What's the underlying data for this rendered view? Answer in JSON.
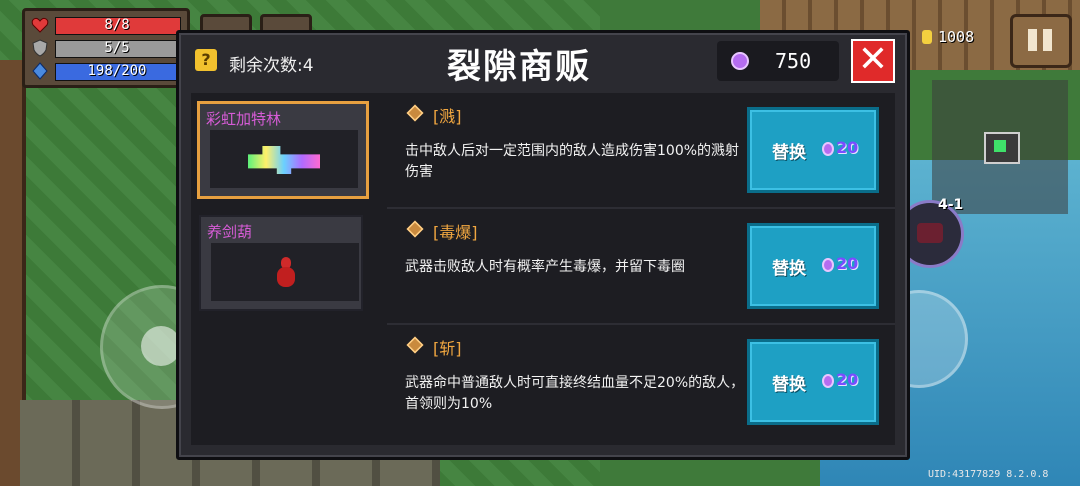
{
  "hud": {
    "hp": {
      "label": "8/8",
      "fraction": 1.0,
      "color": "#e03a3a"
    },
    "armor": {
      "label": "5/5",
      "fraction": 1.0,
      "color": "#9a9a9a"
    },
    "energy": {
      "label": "198/200",
      "fraction": 0.99,
      "color": "#3a6ae0"
    },
    "coins": "1008",
    "level": "4-1",
    "uid": "UID:43177829 8.2.0.8"
  },
  "shop": {
    "remaining_label": "剩余次数:4",
    "title": "裂隙商贩",
    "gems": "750",
    "close_symbol": "✕",
    "weapons": [
      {
        "name": "彩虹加特林",
        "selected": true,
        "icon": "rainbow-gatling-icon"
      },
      {
        "name": "养剑葫",
        "selected": false,
        "icon": "sword-gourd-icon"
      }
    ],
    "traits": [
      {
        "name": "[溅]",
        "desc": "击中敌人后对一定范围内的敌人造成伤害100%的溅射伤害",
        "button": "替换",
        "cost": "20"
      },
      {
        "name": "[毒爆]",
        "desc": "武器击败敌人时有概率产生毒爆，并留下毒圈",
        "button": "替换",
        "cost": "20"
      },
      {
        "name": "[斩]",
        "desc": "武器命中普通敌人时可直接终结血量不足20%的敌人，首领则为10%",
        "button": "替换",
        "cost": "20"
      }
    ]
  },
  "colors": {
    "accent": "#e7a040",
    "button": "#1ea0c4",
    "close": "#e02a2a",
    "weapon_name": "#d65cd6",
    "gem": "#b56cf0"
  }
}
